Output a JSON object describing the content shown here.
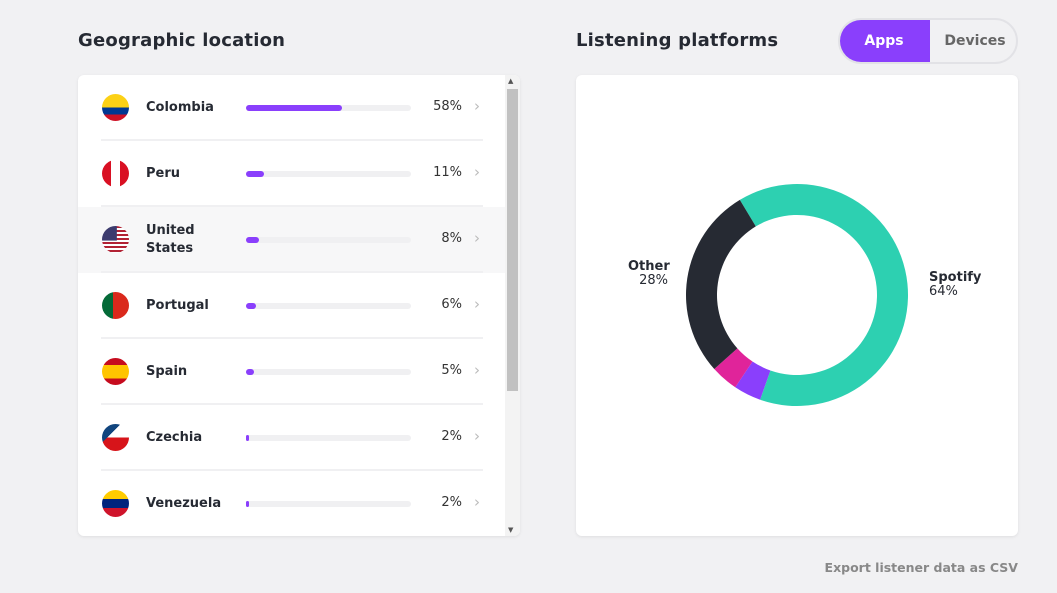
{
  "geo": {
    "title": "Geographic location",
    "rows": [
      {
        "name": "Colombia",
        "pct": "58%",
        "value": 58,
        "flag": "colombia"
      },
      {
        "name": "Peru",
        "pct": "11%",
        "value": 11,
        "flag": "peru"
      },
      {
        "name": "United States",
        "pct": "8%",
        "value": 8,
        "flag": "usa"
      },
      {
        "name": "Portugal",
        "pct": "6%",
        "value": 6,
        "flag": "portugal"
      },
      {
        "name": "Spain",
        "pct": "5%",
        "value": 5,
        "flag": "spain"
      },
      {
        "name": "Czechia",
        "pct": "2%",
        "value": 2,
        "flag": "czechia"
      },
      {
        "name": "Venezuela",
        "pct": "2%",
        "value": 2,
        "flag": "venezuela"
      }
    ],
    "bar_color": "#8a3ffc"
  },
  "platforms": {
    "title": "Listening platforms",
    "tabs": [
      "Apps",
      "Devices"
    ],
    "active_tab": "Apps",
    "labels": {
      "spotify_name": "Spotify",
      "spotify_pct": "64%",
      "other_name": "Other",
      "other_pct": "28%"
    }
  },
  "chart_data": {
    "type": "pie",
    "donut": true,
    "slices": [
      {
        "name": "Spotify",
        "value": 64,
        "color": "#2dd0b1"
      },
      {
        "value": 4,
        "color": "#8a3ffc"
      },
      {
        "value": 4,
        "color": "#e0249a"
      },
      {
        "name": "Other",
        "value": 28,
        "color": "#262a33"
      }
    ]
  },
  "export_label": "Export listener data as CSV"
}
